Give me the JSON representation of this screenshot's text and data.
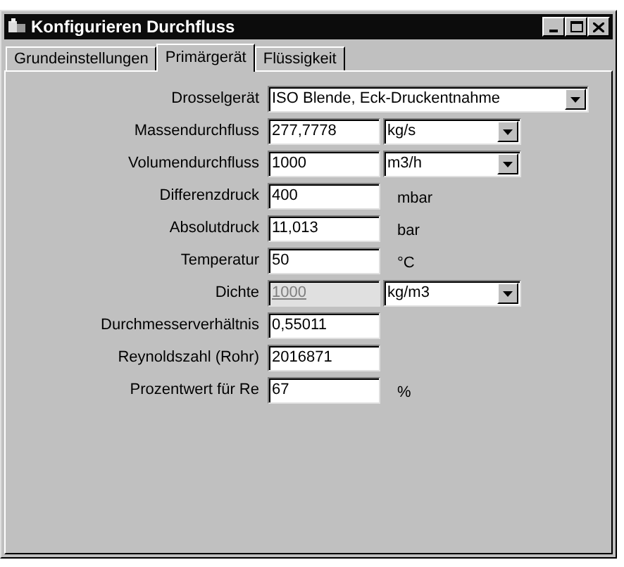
{
  "window": {
    "title": "Konfigurieren Durchfluss"
  },
  "tabs": [
    {
      "label": "Grundeinstellungen",
      "selected": false
    },
    {
      "label": "Primärgerät",
      "selected": true
    },
    {
      "label": "Flüssigkeit",
      "selected": false
    }
  ],
  "rows": [
    {
      "kind": "select",
      "label": "Drosselgerät",
      "value": "ISO Blende, Eck-Druckentnahme",
      "disabled": false
    },
    {
      "kind": "value-select",
      "label": "Massendurchfluss",
      "value": "277,7778",
      "unit": "kg/s",
      "disabled": false
    },
    {
      "kind": "value-select",
      "label": "Volumendurchfluss",
      "value": "1000",
      "unit": "m3/h",
      "disabled": false
    },
    {
      "kind": "value-unit",
      "label": "Differenzdruck",
      "value": "400",
      "unit": "mbar",
      "disabled": false
    },
    {
      "kind": "value-unit",
      "label": "Absolutdruck",
      "value": "11,013",
      "unit": "bar",
      "disabled": false
    },
    {
      "kind": "value-unit",
      "label": "Temperatur",
      "value": "50",
      "unit": "°C",
      "disabled": false
    },
    {
      "kind": "value-select",
      "label": "Dichte",
      "value": "1000",
      "unit": "kg/m3",
      "disabled": true
    },
    {
      "kind": "value",
      "label": "Durchmesserverhältnis",
      "value": "0,55011",
      "disabled": false
    },
    {
      "kind": "value",
      "label": "Reynoldszahl (Rohr)",
      "value": "2016871",
      "disabled": false
    },
    {
      "kind": "value-unit",
      "label": "Prozentwert für Re",
      "value": "67",
      "unit": "%",
      "disabled": false
    }
  ]
}
